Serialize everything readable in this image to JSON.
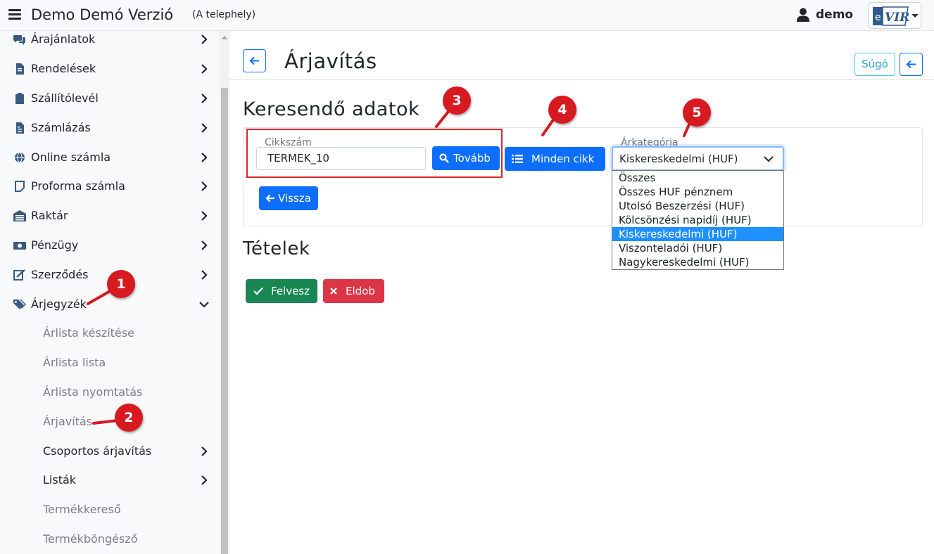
{
  "header": {
    "app_title": "Demo Demó Verzió",
    "app_subtitle": "(A telephely)",
    "user_name": "demo",
    "brand_logo_text": "eVIR"
  },
  "sidebar": {
    "items": [
      {
        "label": "Árajánlatok",
        "icon": "comments-icon"
      },
      {
        "label": "Rendelések",
        "icon": "file-icon"
      },
      {
        "label": "Szállítólevél",
        "icon": "clipboard-icon"
      },
      {
        "label": "Számlázás",
        "icon": "invoice-icon"
      },
      {
        "label": "Online számla",
        "icon": "globe-icon"
      },
      {
        "label": "Proforma számla",
        "icon": "note-icon"
      },
      {
        "label": "Raktár",
        "icon": "warehouse-icon"
      },
      {
        "label": "Pénzügy",
        "icon": "money-icon"
      },
      {
        "label": "Szerződés",
        "icon": "contract-icon"
      },
      {
        "label": "Árjegyzék",
        "icon": "tags-icon"
      }
    ],
    "subitems": [
      "Árlista készítése",
      "Árlista lista",
      "Árlista nyomtatás",
      "Árjavítás",
      "Csoportos árjavítás",
      "Listák",
      "Termékkereső",
      "Termékböngésző"
    ]
  },
  "page": {
    "title": "Árjavítás",
    "help_label": "Súgó"
  },
  "search": {
    "section_title": "Keresendő adatok",
    "sku_legend": "Cikkszám",
    "sku_value": "TERMEK_10",
    "next_label": "Tovább",
    "all_items_label": "Minden cikk",
    "category_legend": "Árkategória",
    "category_selected": "Kiskereskedelmi (HUF)",
    "category_options": [
      "Összes",
      "Összes HUF pénznem",
      "Utolsó Beszerzési (HUF)",
      "Kölcsönzési napidíj (HUF)",
      "Kiskereskedelmi (HUF)",
      "Viszonteladói (HUF)",
      "Nagykereskedelmi (HUF)"
    ],
    "back_label": "Vissza"
  },
  "items": {
    "section_title": "Tételek",
    "add_label": "Felvesz",
    "discard_label": "Eldob"
  },
  "annotations": [
    "1",
    "2",
    "3",
    "4",
    "5"
  ],
  "colors": {
    "primary": "#0d6efd",
    "success": "#198754",
    "danger": "#dc3545",
    "marker": "#d71920",
    "highlight": "#1e90ff"
  }
}
